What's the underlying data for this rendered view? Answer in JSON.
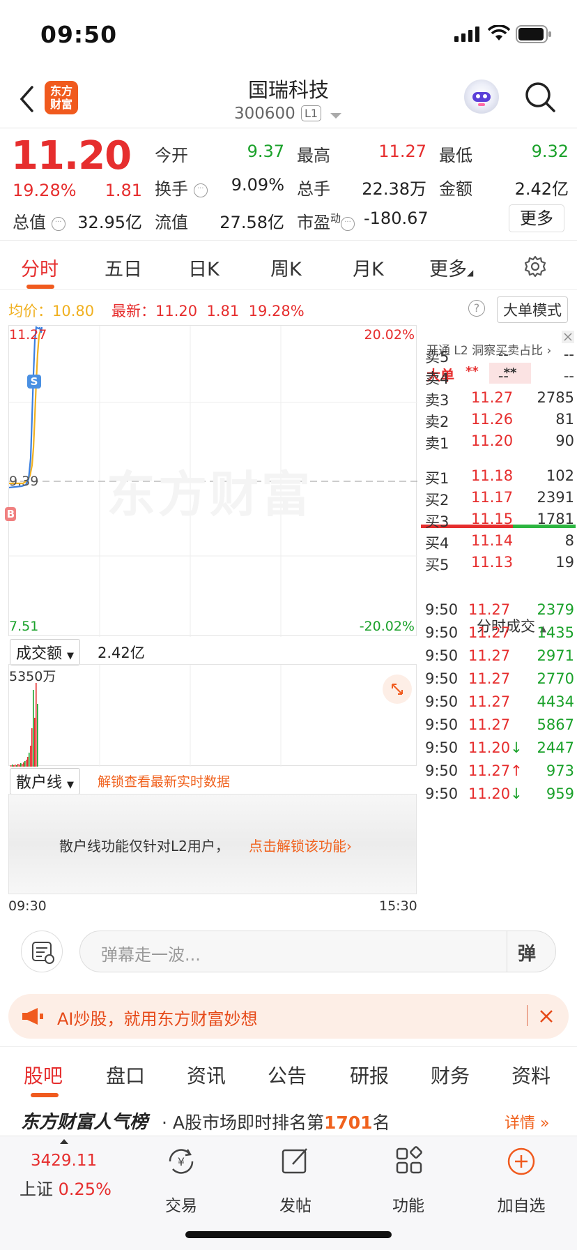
{
  "status": {
    "time": "09:50"
  },
  "header": {
    "logo_line1": "东方",
    "logo_line2": "财富",
    "title": "国瑞科技",
    "code": "300600",
    "market_badge": "L1"
  },
  "quote": {
    "price": "11.20",
    "change_pct": "19.28%",
    "change": "1.81",
    "open_label": "今开",
    "open": "9.37",
    "high_label": "最高",
    "high": "11.27",
    "low_label": "最低",
    "low": "9.32",
    "turnover_label": "换手",
    "turnover": "9.09%",
    "volume_label": "总手",
    "volume": "22.38万",
    "amount_label": "金额",
    "amount": "2.42亿",
    "mcap_label": "总值",
    "mcap": "32.95亿",
    "float_label": "流值",
    "float": "27.58亿",
    "pe_label": "市盈",
    "pe_sup": "动",
    "pe": "-180.67",
    "more_label": "更多"
  },
  "tabs": [
    {
      "label": "分时"
    },
    {
      "label": "五日"
    },
    {
      "label": "日K"
    },
    {
      "label": "周K"
    },
    {
      "label": "月K"
    },
    {
      "label": "更多"
    }
  ],
  "avgbar": {
    "avg_label": "均价：",
    "avg": "10.80",
    "latest_label": "最新：",
    "latest": "11.20",
    "change": "1.81",
    "pct": "19.28%",
    "bigorder_btn": "大单模式"
  },
  "chart": {
    "top_price": "11.27",
    "top_pct": "20.02%",
    "mid_price": "9.39",
    "bottom_price": "7.51",
    "bottom_pct": "-20.02%",
    "s_marker": "S",
    "b_marker": "B",
    "watermark": "东方财富"
  },
  "volume": {
    "selector": "成交额",
    "total": "2.42亿",
    "max_label": "5350万",
    "start_time": "09:30",
    "end_time": "15:30"
  },
  "retail": {
    "selector": "散户线",
    "unlock_hint": "解锁查看最新实时数据",
    "panel_text": "散户线功能仅针对L2用户，",
    "panel_link": "点击解锁该功能"
  },
  "orderbook": {
    "header": "开通 L2 洞察买卖占比",
    "bigorder": "大单",
    "stars1": "**",
    "stars2": "**",
    "asks": [
      {
        "label": "卖5",
        "price": "--",
        "vol": "--"
      },
      {
        "label": "卖4",
        "price": "--",
        "vol": "--"
      },
      {
        "label": "卖3",
        "price": "11.27",
        "vol": "2785"
      },
      {
        "label": "卖2",
        "price": "11.26",
        "vol": "81"
      },
      {
        "label": "卖1",
        "price": "11.20",
        "vol": "90"
      }
    ],
    "bids": [
      {
        "label": "买1",
        "price": "11.18",
        "vol": "102"
      },
      {
        "label": "买2",
        "price": "11.17",
        "vol": "2391"
      },
      {
        "label": "买3",
        "price": "11.15",
        "vol": "1781"
      },
      {
        "label": "买4",
        "price": "11.14",
        "vol": "8"
      },
      {
        "label": "买5",
        "price": "11.13",
        "vol": "19"
      }
    ],
    "ticks_title": "分时成交",
    "ticks": [
      {
        "time": "9:50",
        "price": "11.27",
        "vol": "2379",
        "dir": ""
      },
      {
        "time": "9:50",
        "price": "11.27",
        "vol": "1435",
        "dir": ""
      },
      {
        "time": "9:50",
        "price": "11.27",
        "vol": "2971",
        "dir": ""
      },
      {
        "time": "9:50",
        "price": "11.27",
        "vol": "2770",
        "dir": ""
      },
      {
        "time": "9:50",
        "price": "11.27",
        "vol": "4434",
        "dir": ""
      },
      {
        "time": "9:50",
        "price": "11.27",
        "vol": "5867",
        "dir": ""
      },
      {
        "time": "9:50",
        "price": "11.20",
        "vol": "2447",
        "dir": "↓"
      },
      {
        "time": "9:50",
        "price": "11.27",
        "vol": "973",
        "dir": "↑"
      },
      {
        "time": "9:50",
        "price": "11.20",
        "vol": "959",
        "dir": "↓"
      }
    ]
  },
  "danmu": {
    "placeholder": "弹幕走一波...",
    "send_label": "弹"
  },
  "promo": {
    "text": "AI炒股，就用东方财富妙想"
  },
  "bottom_tabs": [
    {
      "label": "股吧"
    },
    {
      "label": "盘口"
    },
    {
      "label": "资讯"
    },
    {
      "label": "公告"
    },
    {
      "label": "研报"
    },
    {
      "label": "财务"
    },
    {
      "label": "资料"
    }
  ],
  "rank": {
    "title": "东方财富人气榜",
    "text": "· A股市场即时排名第",
    "num": "1701",
    "suffix": "名",
    "detail": "详情"
  },
  "bottombar": {
    "index_value": "3429.11",
    "index_name": "上证",
    "index_pct": "0.25%",
    "trade": "交易",
    "post": "发帖",
    "func": "功能",
    "add": "加自选"
  },
  "colors": {
    "up": "#e62e2e",
    "down": "#1aa12a",
    "accent": "#f05a1e",
    "avg_line": "#f0b020",
    "price_line": "#3a7fe0"
  }
}
